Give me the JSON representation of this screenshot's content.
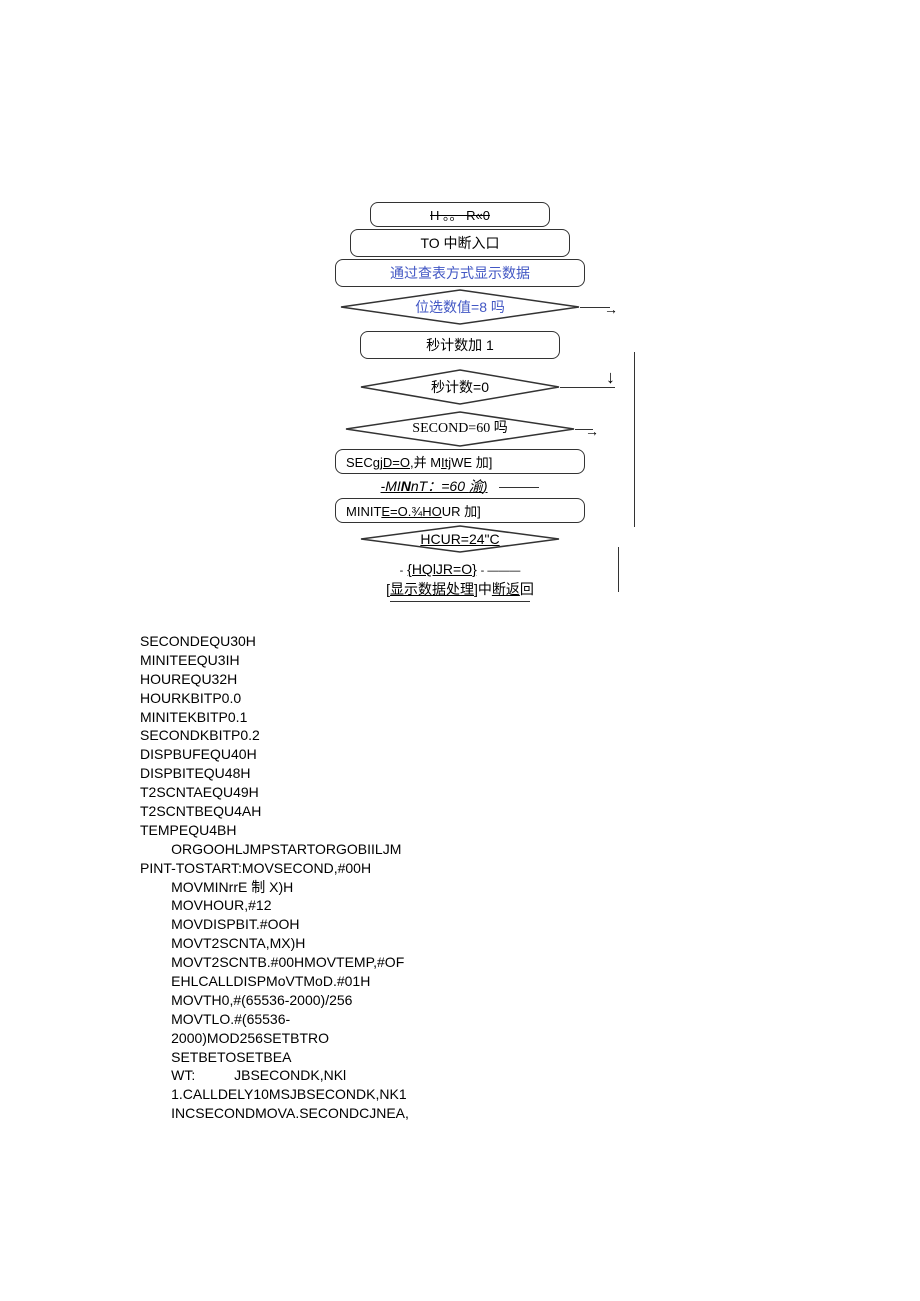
{
  "flow": {
    "n1": "H 。。 R«0",
    "n2": "TO 中断入口",
    "n3": "通过查表方式显示数据",
    "d1": "位选数值=8 吗",
    "n4": "秒计数加 1",
    "n5": "秒计数=0",
    "d2": "SECOND=60 吗",
    "n6": "SECgjD=O,并 MItjWE 加]",
    "n7": "-MINnT：=60 渝)",
    "n8": "MINITE=O.¾HOUR 加]",
    "n9": "HCUR=24\"C",
    "n10": "{HQlJR=O}-",
    "n11": "[显示数据处理]中断返回"
  },
  "code": [
    "SECONDEQU30H",
    "MINITEEQU3IH",
    "HOUREQU32H",
    "HOURKBITP0.0",
    "MINITEKBITP0.1",
    "SECONDKBITP0.2",
    "DISPBUFEQU40H",
    "DISPBITEQU48H",
    "T2SCNTAEQU49H",
    "T2SCNTBEQU4AH",
    "TEMPEQU4BH",
    "        ORGOOHLJMPSTARTORGOBIILJM",
    "PINT-TOSTART:MOVSECOND,#00H",
    "        MOVMINrrE 制 X)H",
    "        MOVHOUR,#12",
    "        MOVDISPBIT.#OOH",
    "        MOVT2SCNTA,MX)H",
    "        MOVT2SCNTB.#00HMOVTEMP,#OF",
    "        EHLCALLDISPMoVTMoD.#01H",
    "        MOVTH0,#(65536-2000)/256",
    "        MOVTLO.#(65536-",
    "        2000)MOD256SETBTRO",
    "        SETBETOSETBEA",
    "        WT:          JBSECONDK,NKl",
    "        1.CALLDELY10MSJBSECONDK,NK1",
    "        INCSECONDMOVA.SECONDCJNEA,"
  ]
}
